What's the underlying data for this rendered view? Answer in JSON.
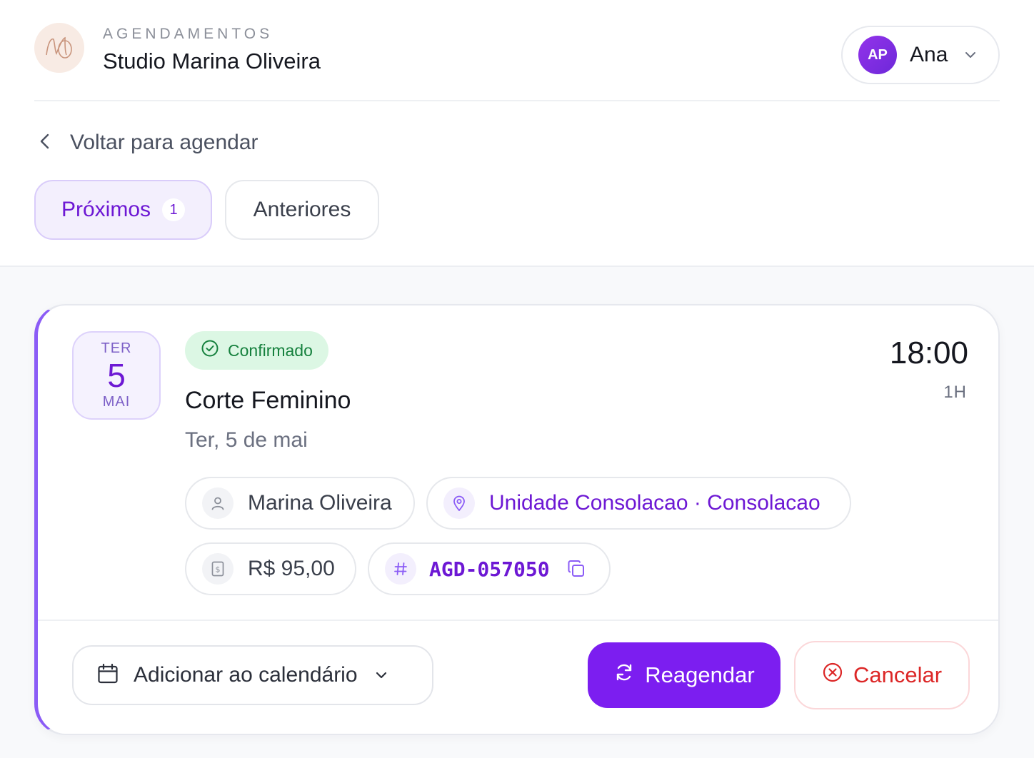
{
  "header": {
    "kicker": "AGENDAMENTOS",
    "studio_name": "Studio Marina Oliveira",
    "logo_icon": "studio-logo",
    "user": {
      "initials": "AP",
      "name": "Ana"
    }
  },
  "nav": {
    "back_label": "Voltar para agendar"
  },
  "tabs": {
    "upcoming_label": "Próximos",
    "upcoming_count": "1",
    "past_label": "Anteriores"
  },
  "appointment": {
    "weekday_short": "TER",
    "day": "5",
    "month_short": "MAI",
    "status": "Confirmado",
    "service": "Corte Feminino",
    "date_long": "Ter, 5 de mai",
    "time": "18:00",
    "duration": "1H",
    "professional": "Marina Oliveira",
    "location": "Unidade Consolacao · Consolacao",
    "price": "R$ 95,00",
    "code": "AGD-057050",
    "accent_color": "#8b5cf6"
  },
  "actions": {
    "add_calendar": "Adicionar ao calendário",
    "reschedule": "Reagendar",
    "cancel": "Cancelar"
  }
}
